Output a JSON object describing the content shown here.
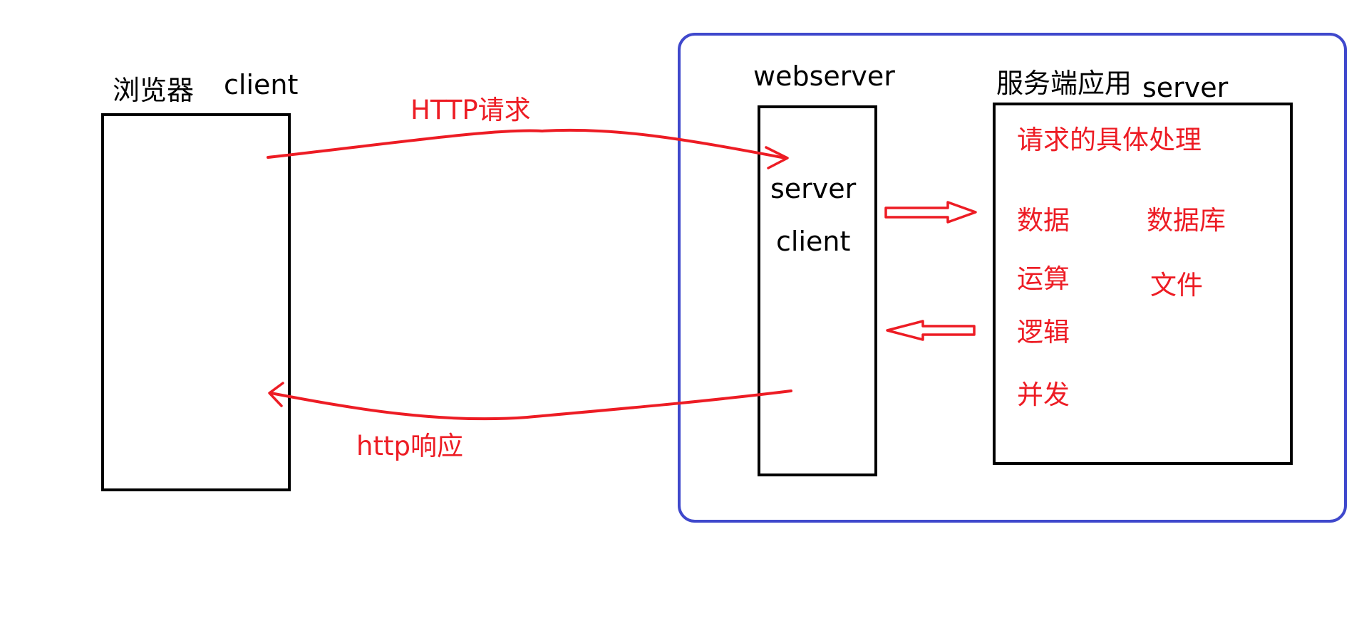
{
  "colors": {
    "outline": "#000000",
    "annotation": "#ed1c24",
    "frame": "#3f48cc",
    "background": "#ffffff"
  },
  "browser": {
    "label_cn": "浏览器",
    "label_en": "client"
  },
  "request": {
    "label": "HTTP请求"
  },
  "response": {
    "label": "http响应"
  },
  "webserver": {
    "title": "webserver",
    "line1": "server",
    "line2": "client"
  },
  "app": {
    "title_cn": "服务端应用",
    "title_en": "server",
    "heading": "请求的具体处理",
    "items_left": [
      "数据",
      "运算",
      "逻辑",
      "并发"
    ],
    "items_right": [
      "数据库",
      "文件"
    ]
  }
}
